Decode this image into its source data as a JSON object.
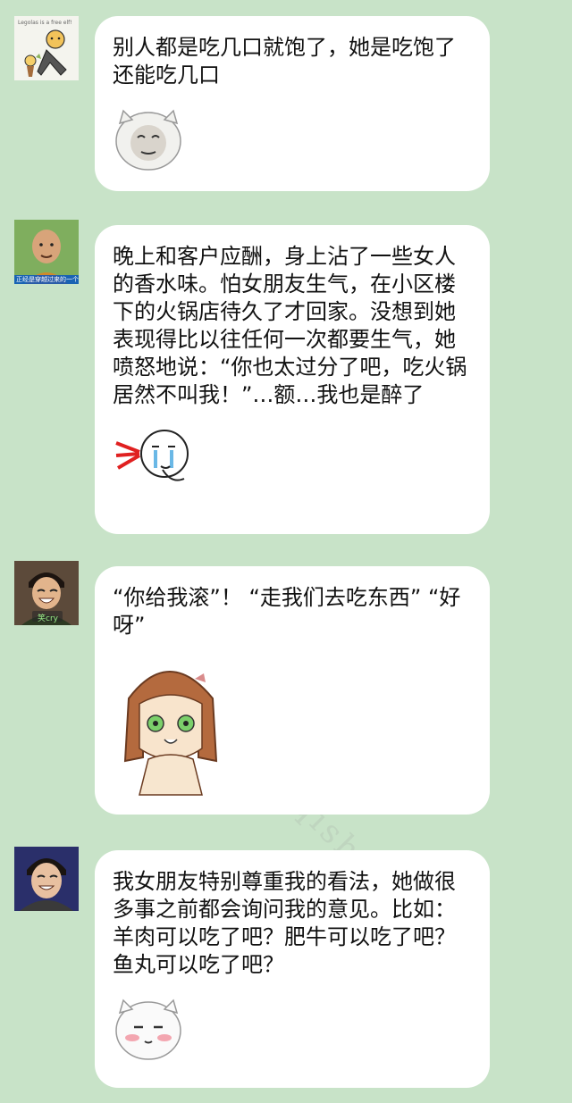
{
  "messages": [
    {
      "text": "别人都是吃几口就饱了，她是吃饱了还能吃几口",
      "avatar_caption": "Legolas is a free elf!",
      "sticker": "chubby-face-meme-sticker"
    },
    {
      "text": "晚上和客户应酬，身上沾了一些女人的香水味。怕女朋友生气，在小区楼下的火锅店待久了才回家。没想到她表现得比以往任何一次都要生气，她喷怒地说：“你也太过分了吧，吃火锅居然不叫我！”…额…我也是醉了",
      "avatar_caption": "正经是穿越过来的一个美男子",
      "sticker": "crying-nosebleed-sticker"
    },
    {
      "text": "“你给我滚”！ “走我们去吃东西” “好呀”",
      "avatar_caption": "笑cry",
      "sticker": "anime-girl-sticker"
    },
    {
      "text": "我女朋友特别尊重我的看法，她做很多事之前都会询问我的意见。比如：羊肉可以吃了吧？肥牛可以吃了吧？鱼丸可以吃了吧？",
      "avatar_caption": "",
      "sticker": "blushing-face-sticker"
    }
  ],
  "watermark": "信：yiqishu08",
  "colors": {
    "background": "#c8e3c8",
    "bubble": "#ffffff",
    "text": "#111111"
  }
}
